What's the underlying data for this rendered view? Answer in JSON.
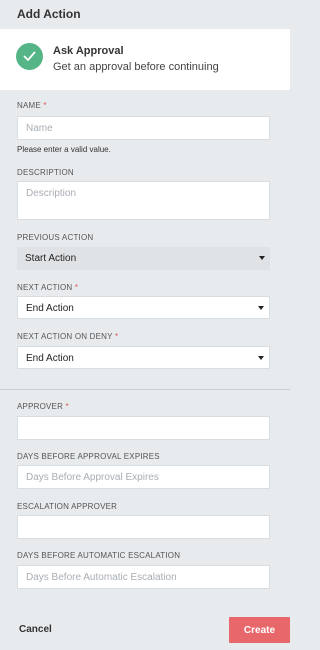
{
  "header": {
    "title": "Add Action"
  },
  "summary": {
    "icon": "check-icon",
    "title": "Ask Approval",
    "description": "Get an approval before continuing",
    "accent_color": "#56b587"
  },
  "form": {
    "required_mark": "*",
    "name": {
      "label": "NAME",
      "placeholder": "Name",
      "value": "",
      "error": "Please enter a valid value."
    },
    "description": {
      "label": "DESCRIPTION",
      "placeholder": "Description",
      "value": ""
    },
    "previous_action": {
      "label": "PREVIOUS ACTION",
      "value": "Start Action"
    },
    "next_action": {
      "label": "NEXT ACTION",
      "value": "End Action"
    },
    "next_action_on_deny": {
      "label": "NEXT ACTION ON DENY",
      "value": "End Action"
    },
    "approver": {
      "label": "APPROVER",
      "placeholder": "",
      "value": ""
    },
    "days_before_expiry": {
      "label": "DAYS BEFORE APPROVAL EXPIRES",
      "placeholder": "Days Before Approval Expires",
      "value": ""
    },
    "escalation_approver": {
      "label": "ESCALATION APPROVER",
      "placeholder": "",
      "value": ""
    },
    "days_before_escalation": {
      "label": "DAYS BEFORE AUTOMATIC ESCALATION",
      "placeholder": "Days Before Automatic Escalation",
      "value": ""
    }
  },
  "footer": {
    "cancel_label": "Cancel",
    "create_label": "Create",
    "create_color": "#e8676a"
  }
}
